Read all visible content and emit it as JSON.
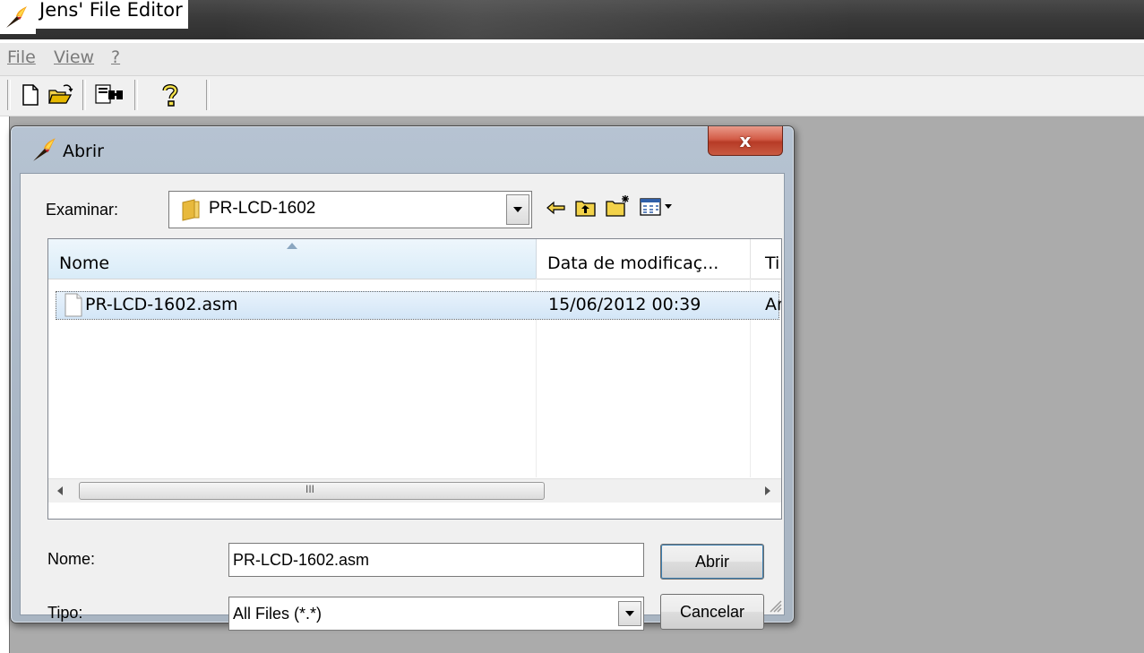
{
  "app": {
    "title": "Jens' File Editor"
  },
  "menu": [
    {
      "label": "File"
    },
    {
      "label": "View"
    },
    {
      "label": "?"
    }
  ],
  "toolbar": {
    "icons": [
      "new-file-icon",
      "open-folder-icon",
      "find-icon",
      "help-icon"
    ]
  },
  "dialog": {
    "title": "Abrir",
    "close_label": "x",
    "look_in": {
      "label": "Examinar:",
      "value": "PR-LCD-1602"
    },
    "nav_icons": [
      "back-arrow-icon",
      "up-folder-icon",
      "new-folder-icon",
      "view-menu-icon"
    ],
    "columns": [
      {
        "label": "Nome"
      },
      {
        "label": "Data de modificaç..."
      },
      {
        "label": "Ti"
      }
    ],
    "files": [
      {
        "name": "PR-LCD-1602.asm",
        "modified": "15/06/2012 00:39",
        "type": "Ar"
      }
    ],
    "scroll_marker": "III",
    "filename": {
      "label": "Nome:",
      "value": "PR-LCD-1602.asm"
    },
    "filetype": {
      "label": "Tipo:",
      "value": "All Files (*.*)"
    },
    "buttons": {
      "open": "Abrir",
      "cancel": "Cancelar"
    }
  },
  "colors": {
    "titlebar": "#3a3a3a",
    "workspace": "#ababab",
    "dialog_frame": "#aab7c6",
    "close_button": "#c94c36",
    "selection": "#d3e6f7"
  }
}
